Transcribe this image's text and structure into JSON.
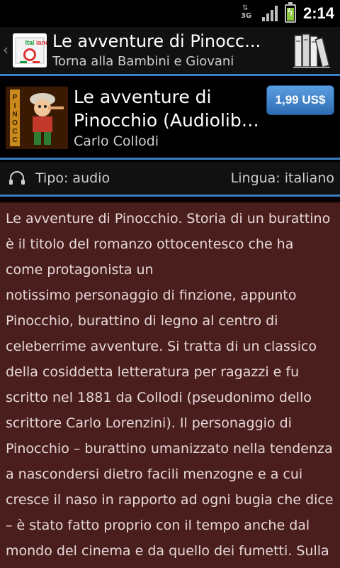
{
  "status_bar": {
    "network": "3G",
    "clock": "2:14",
    "battery_level": 0.8,
    "icons": [
      "3g-data-icon",
      "signal-strength-icon",
      "battery-charging-icon"
    ]
  },
  "app_header": {
    "title": "Le avventure di Pinocc...",
    "subtitle": "Torna alla Bambini e Giovani",
    "logo_text": "Italiano",
    "icons": [
      "back-chevron-icon",
      "app-logo-icon",
      "bookshelf-icon"
    ]
  },
  "product": {
    "title_line1": "Le avventure di",
    "title_line2": "Pinocchio (Audiolibro)",
    "author": "Carlo Collodi",
    "price_label": "1,99 US$",
    "cover_text": "PINOCCHIO"
  },
  "info_row": {
    "type_label": "Tipo: audio",
    "language_label": "Lingua: italiano",
    "icon": "headphones-icon"
  },
  "description": {
    "text": "Le avventure di Pinocchio. Storia di un burattino è il titolo del romanzo ottocentesco che ha come protagonista un\nnotissimo personaggio di finzione, appunto Pinocchio, burattino di legno al centro di celeberrime avventure. Si tratta di un classico della cosiddetta letteratura per ragazzi e fu scritto nel 1881 da Collodi (pseudonimo dello scrittore Carlo Lorenzini). Il personaggio di Pinocchio – burattino umanizzato nella tendenza a nascondersi dietro facili menzogne e a cui cresce il naso in rapporto ad ogni bugia che dice – è stato fatto proprio con il tempo anche dal mondo del cinema e da quello dei fumetti. Sulla sua"
  },
  "colors": {
    "accent_blue": "#3a7fc1",
    "description_bg": "#4b1e1e",
    "price_button": "#3d83cf"
  }
}
